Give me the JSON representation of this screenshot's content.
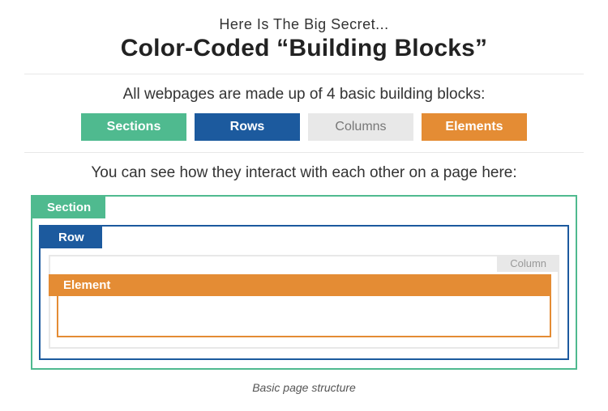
{
  "header": {
    "pre_title": "Here Is The Big Secret...",
    "title": "Color-Coded “Building Blocks”"
  },
  "intro": "All webpages are made up of 4 basic building blocks:",
  "blocks": {
    "sections": "Sections",
    "rows": "Rows",
    "columns": "Columns",
    "elements": "Elements"
  },
  "sub_intro": "You can see how they interact with each other on a page here:",
  "diagram": {
    "section_label": "Section",
    "row_label": "Row",
    "column_label": "Column",
    "element_label": "Element"
  },
  "caption": "Basic page structure",
  "colors": {
    "section": "#4fba8f",
    "row": "#1c5a9e",
    "column": "#e8e8e8",
    "element": "#e48c34"
  }
}
